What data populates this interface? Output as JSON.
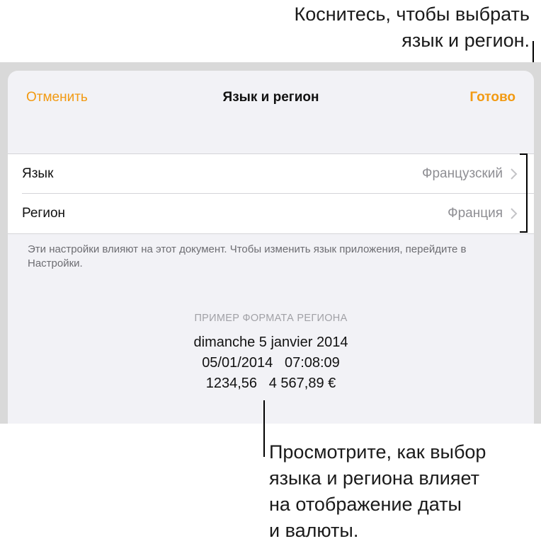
{
  "callouts": {
    "top": [
      "Коснитесь, чтобы выбрать",
      "язык и регион."
    ],
    "bottom": [
      "Просмотрите, как выбор",
      "языка и региона влияет",
      "на отображение даты",
      "и валюты."
    ]
  },
  "navbar": {
    "cancel_label": "Отменить",
    "title": "Язык и регион",
    "done_label": "Готово"
  },
  "settings": {
    "rows": [
      {
        "label": "Язык",
        "value": "Французский"
      },
      {
        "label": "Регион",
        "value": "Франция"
      }
    ],
    "footnote": "Эти настройки влияют на этот документ. Чтобы изменить язык приложения, перейдите в Настройки."
  },
  "sample": {
    "header": "ПРИМЕР ФОРМАТА РЕГИОНА",
    "date_long": "dimanche 5 janvier 2014",
    "date_time": "05/01/2014   07:08:09",
    "numbers": "1234,56   4 567,89 €"
  },
  "colors": {
    "accent": "#f29a12",
    "secondary_text": "#8e8e93",
    "sheet_background": "#f2f2f6"
  }
}
